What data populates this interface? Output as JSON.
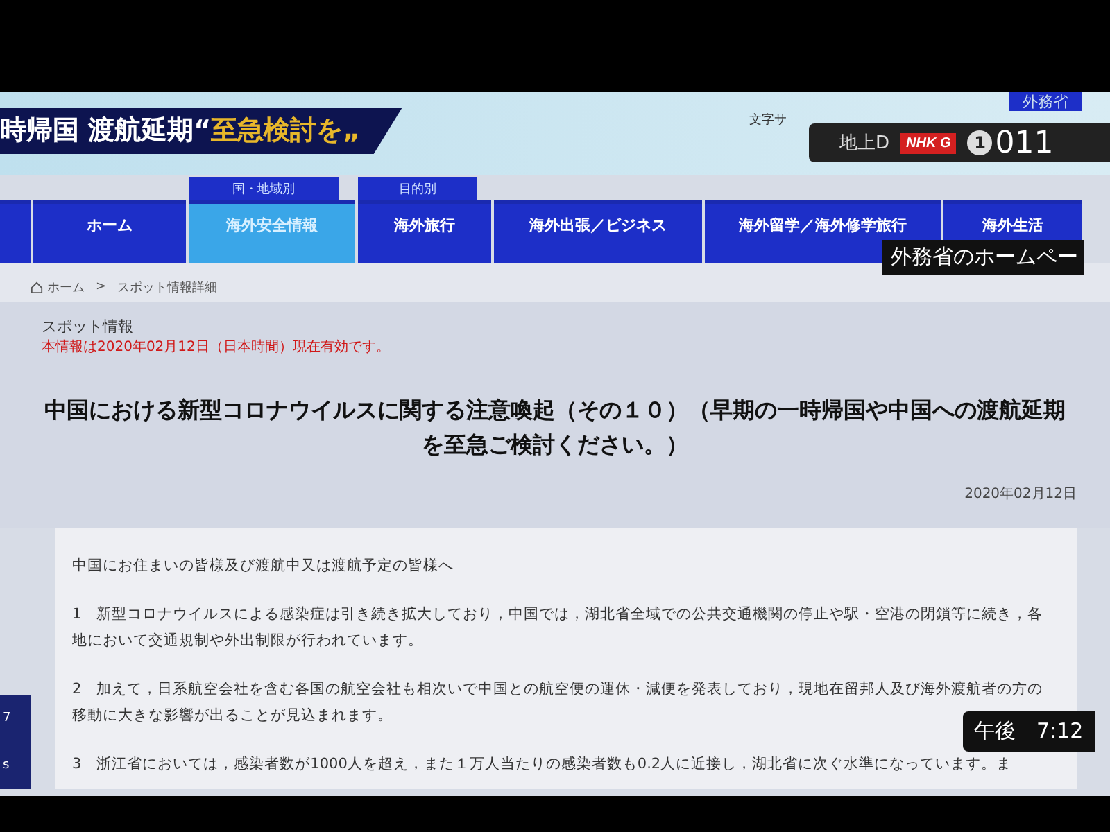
{
  "header": {
    "site_label": "外務省",
    "text_size_label": "文字サ"
  },
  "tv_caption": {
    "plain": "時帰国 渡航延期“",
    "emphasis": "至急検討を„"
  },
  "tv_channel": {
    "network": "地上D",
    "logo": "NHK G",
    "channel_number": "1",
    "channel_code": "011"
  },
  "tv_subtitle": "外務省のホームペー",
  "tv_time": "午後　7:12",
  "nav": [
    {
      "selected": false
    },
    {
      "label": "ホーム",
      "selected": false
    },
    {
      "label": "海外安全情報",
      "tag": "国・地域別",
      "selected": true
    },
    {
      "label": "海外旅行",
      "tag": "目的別",
      "selected": false
    },
    {
      "label": "海外出張／ビジネス",
      "selected": false
    },
    {
      "label": "海外留学／海外修学旅行",
      "selected": false
    },
    {
      "label": "海外生活",
      "selected": false
    }
  ],
  "breadcrumb": [
    "ホーム",
    "スポット情報詳細"
  ],
  "breadcrumb_separator": ">",
  "section_label": "スポット情報",
  "validity_notice": "本情報は2020年02月12日（日本時間）現在有効です。",
  "title": "中国における新型コロナウイルスに関する注意喚起（その１０）（早期の一時帰国や中国への渡航延期を至急ご検討ください。）",
  "date": "2020年02月12日",
  "side_tab": [
    "7",
    "s"
  ],
  "body": [
    "中国にお住まいの皆様及び渡航中又は渡航予定の皆様へ",
    "1　新型コロナウイルスによる感染症は引き続き拡大しており，中国では，湖北省全域での公共交通機関の停止や駅・空港の閉鎖等に続き，各地において交通規制や外出制限が行われています。",
    "2　加えて，日系航空会社を含む各国の航空会社も相次いで中国との航空便の運休・減便を発表しており，現地在留邦人及び海外渡航者の方の移動に大きな影響が出ることが見込まれます。",
    "3　浙江省においては，感染者数が1000人を超え，また１万人当たりの感染者数も0.2人に近接し，湖北省に次ぐ水準になっています。ま"
  ]
}
